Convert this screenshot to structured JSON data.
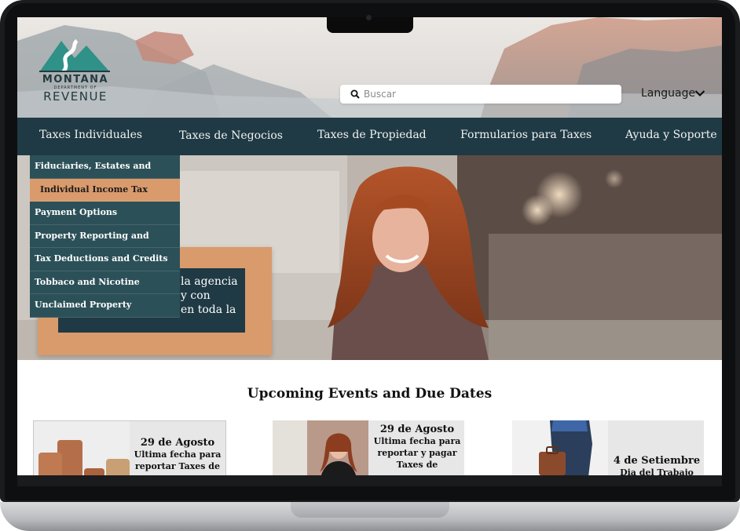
{
  "header": {
    "logo": {
      "line1": "MONTANA",
      "line2": "DEPARTMENT OF",
      "line3": "REVENUE"
    },
    "search": {
      "placeholder": "Buscar",
      "icon": "search-icon"
    },
    "language": {
      "label": "Language",
      "icon": "chevron-down-icon"
    }
  },
  "nav": {
    "items": [
      {
        "label": "Taxes Individuales"
      },
      {
        "label": "Taxes de Negocios"
      },
      {
        "label": "Taxes de Propiedad"
      },
      {
        "label": "Formularios para Taxes"
      },
      {
        "label": "Ayuda y Soporte"
      }
    ]
  },
  "dropdown": {
    "items": [
      {
        "label": "Fiduciaries, Estates and Trusts"
      },
      {
        "label": "Individual Income Tax"
      },
      {
        "label": "Payment Options"
      },
      {
        "label": "Property Reporting and Surveys"
      },
      {
        "label": "Tax Deductions and Credits"
      },
      {
        "label": "Tobbaco and Nicotine"
      },
      {
        "label": "Unclaimed Property"
      }
    ],
    "active_index": 1
  },
  "hero": {
    "lines": [
      "la agencia",
      "y con",
      "en toda la"
    ]
  },
  "events": {
    "title": "Upcoming Events and Due Dates",
    "items": [
      {
        "date": "29 de Agosto",
        "desc": [
          "Ultima fecha para",
          "reportar Taxes de"
        ]
      },
      {
        "date": "29 de Agosto",
        "desc": [
          "Ultima fecha para",
          "reportar y pagar",
          "Taxes de"
        ]
      },
      {
        "date": "4 de Setiembre",
        "desc": [
          "Dia del Trabajo"
        ]
      }
    ]
  },
  "colors": {
    "nav_bg": "#1f3a44",
    "accent": "#d99a6c",
    "dropdown_bg": "#2c5058",
    "logo_teal": "#2f9188"
  }
}
